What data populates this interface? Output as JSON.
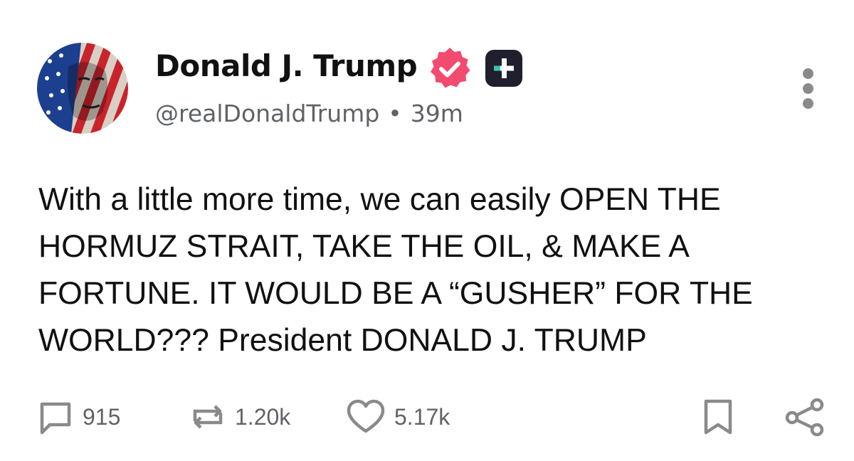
{
  "author": {
    "display_name": "Donald J. Trump",
    "handle": "@realDonaldTrump",
    "separator": "•",
    "time_ago": "39m",
    "verified_icon": "verified-badge-icon",
    "subscriber_icon": "plus-badge-icon",
    "avatar_description_icon": "avatar-flag-face"
  },
  "post": {
    "text": "With a little more time, we can easily OPEN THE HORMUZ STRAIT, TAKE THE OIL, & MAKE A FORTUNE. IT WOULD BE A “GUSHER” FOR THE WORLD??? President DONALD J. TRUMP"
  },
  "actions": {
    "replies": "915",
    "reposts": "1.20k",
    "likes": "5.17k"
  },
  "colors": {
    "verified": "#f24b6e",
    "plus_badge": "#1f1f2e",
    "plus_accent": "#36c9a5",
    "muted_text": "#5f6368",
    "icon_gray": "#8a8a8a"
  }
}
